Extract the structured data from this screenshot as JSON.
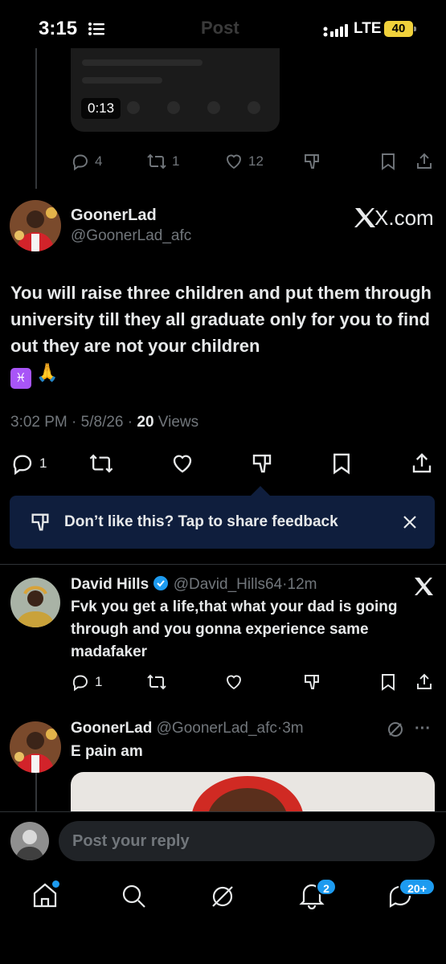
{
  "status_bar": {
    "time": "3:15",
    "network": "LTE",
    "battery": "40"
  },
  "header": {
    "title": "Post"
  },
  "previous_tweet": {
    "video_duration": "0:13",
    "replies": "4",
    "reposts": "1",
    "likes": "12"
  },
  "main_tweet": {
    "author_name": "GoonerLad",
    "handle": "@GoonerLad_afc",
    "source_label": "X.com",
    "text": "You will raise three children and put them through university till they all graduate only for you to find out they are not your children",
    "emoji_suffix": "🙏",
    "time": "3:02 PM",
    "date": "5/8/26",
    "views_count": "20",
    "views_label": "Views",
    "replies": "1"
  },
  "feedback_banner": {
    "text": "Don’t like this? Tap to share feedback"
  },
  "reply_1": {
    "author_name": "David Hills",
    "handle": "@David_Hills64",
    "age": "12m",
    "text": "Fvk you get a life,that what your dad is going through and you gonna experience same madafaker",
    "replies": "1"
  },
  "reply_2": {
    "author_name": "GoonerLad",
    "handle": "@GoonerLad_afc",
    "age": "3m",
    "text": "E pain am"
  },
  "composer": {
    "placeholder": "Post your reply"
  },
  "bottom_nav": {
    "notifications_badge": "2",
    "messages_badge": "20+"
  },
  "colors": {
    "accent": "#1d9bf0",
    "muted": "#71767b",
    "banner": "#0f1e3d"
  }
}
